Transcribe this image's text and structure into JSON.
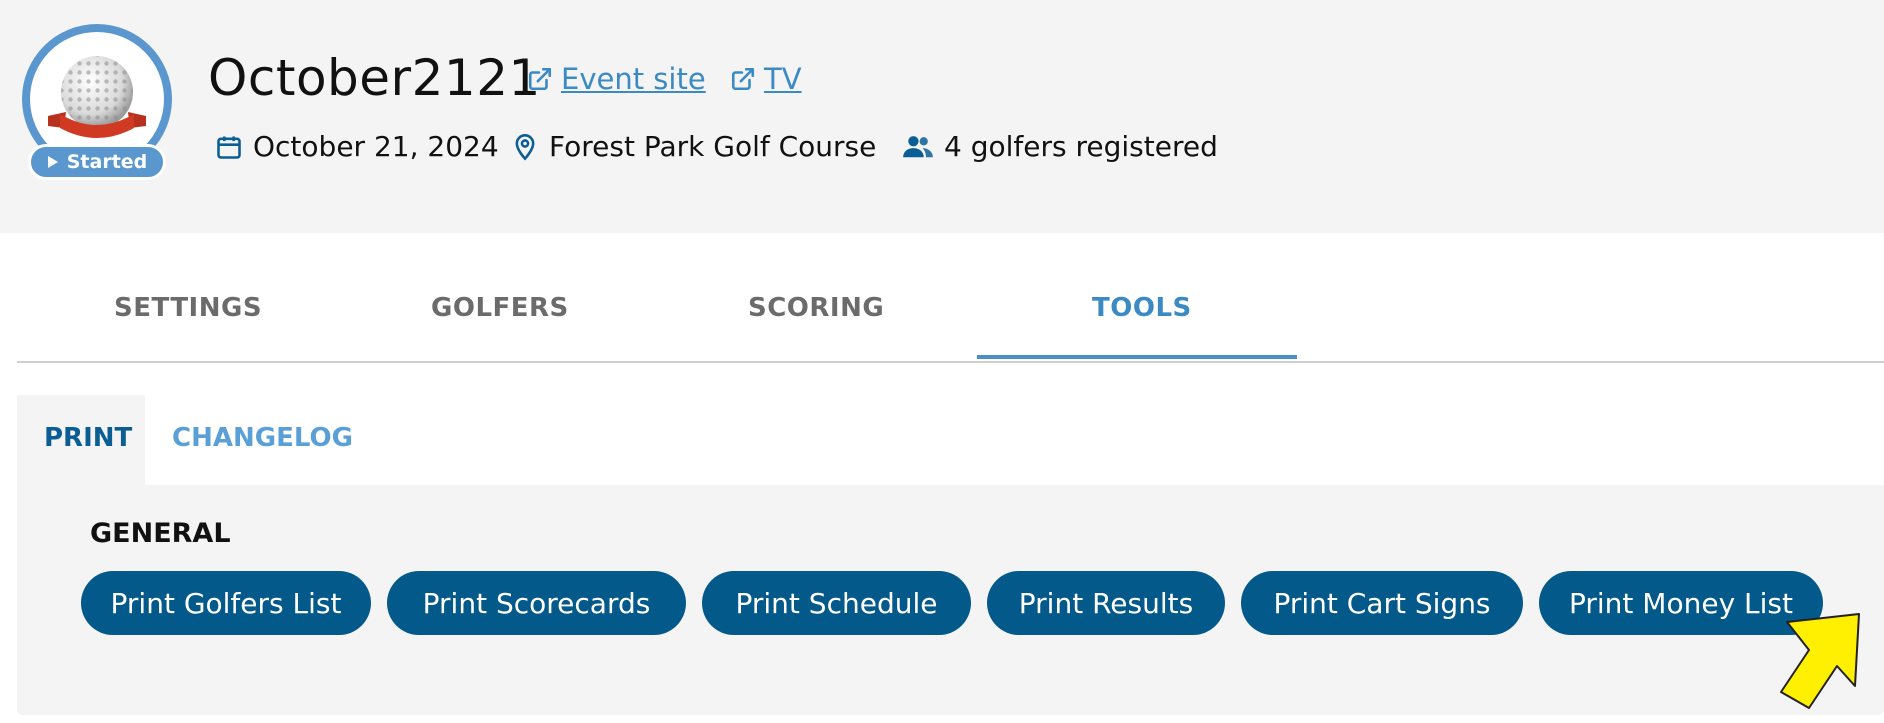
{
  "event": {
    "title": "October2121",
    "status": "Started",
    "links": [
      {
        "label": "Event site",
        "icon": "external-link-icon"
      },
      {
        "label": "TV",
        "icon": "external-link-icon"
      }
    ],
    "meta": {
      "date": "October 21, 2024",
      "location": "Forest Park Golf Course",
      "registered": "4 golfers registered"
    }
  },
  "tabs": {
    "items": [
      "SETTINGS",
      "GOLFERS",
      "SCORING",
      "TOOLS"
    ],
    "active": "TOOLS"
  },
  "subtabs": {
    "items": [
      "PRINT",
      "CHANGELOG"
    ],
    "active": "PRINT"
  },
  "print": {
    "section_title": "GENERAL",
    "buttons": [
      "Print Golfers List",
      "Print Scorecards",
      "Print Schedule",
      "Print Results",
      "Print Cart Signs",
      "Print Money List"
    ]
  },
  "colors": {
    "accent": "#3b8ac4",
    "button": "#03598a",
    "status": "#5b97cf",
    "header_bg": "#f4f4f4"
  }
}
